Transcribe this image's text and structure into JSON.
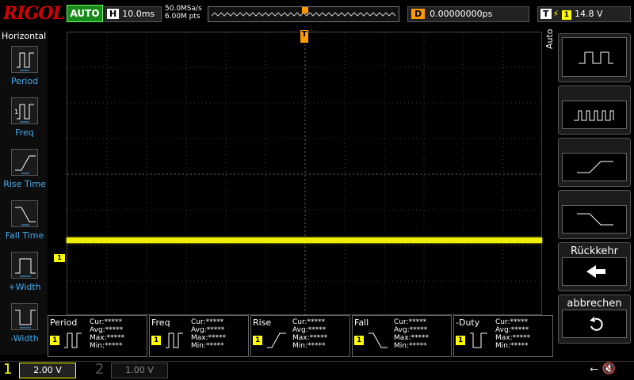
{
  "brand": "RIGOL",
  "mode": "AUTO",
  "horizontal": {
    "label": "H",
    "timebase": "10.0ms"
  },
  "acquisition": {
    "sample_rate": "50.0MSa/s",
    "memory": "6.00M pts"
  },
  "delay": {
    "label": "D",
    "value": "0.00000000ps"
  },
  "trigger": {
    "label": "T",
    "source": "1",
    "level": "14.8 V",
    "slope_icon": "rising-edge-icon",
    "marker": "T"
  },
  "left_menu": {
    "title": "Horizontal",
    "items": [
      {
        "label": "Period",
        "icon": "period-icon"
      },
      {
        "label": "Freq",
        "icon": "frequency-icon"
      },
      {
        "label": "Rise Time",
        "icon": "rise-time-icon"
      },
      {
        "label": "Fall Time",
        "icon": "fall-time-icon"
      },
      {
        "label": "+Width",
        "icon": "positive-width-icon"
      },
      {
        "label": "-Width",
        "icon": "negative-width-icon"
      }
    ]
  },
  "right_menu": {
    "auto_label": "Auto",
    "back_label": "Rückkehr",
    "cancel_label": "abbrechen",
    "back_icon": "back-arrow-icon",
    "cancel_icon": "undo-icon"
  },
  "measurements": [
    {
      "name": "Period",
      "cur": "Cur:*****",
      "avg": "Avg:*****",
      "max": "Max:*****",
      "min": "Min:*****"
    },
    {
      "name": "Freq",
      "cur": "Cur:*****",
      "avg": "Avg:*****",
      "max": "Max:*****",
      "min": "Min:*****"
    },
    {
      "name": "Rise",
      "cur": "Cur:*****",
      "avg": "Avg:*****",
      "max": "Max:*****",
      "min": "Min:*****"
    },
    {
      "name": "Fall",
      "cur": "Cur:*****",
      "avg": "Avg:*****",
      "max": "Max:*****",
      "min": "Min:*****"
    },
    {
      "name": "-Duty",
      "cur": "Cur:*****",
      "avg": "Avg:*****",
      "max": "Max:*****",
      "min": "Min:*****"
    }
  ],
  "channels": {
    "ch1": {
      "num": "1",
      "scale": "2.00 V",
      "marker": "1",
      "color": "#ffff00"
    },
    "ch2": {
      "num": "2",
      "scale": "1.00 V"
    }
  },
  "status": {
    "usb_icon": "usb-icon",
    "mute_icon": "speaker-mute-icon"
  }
}
